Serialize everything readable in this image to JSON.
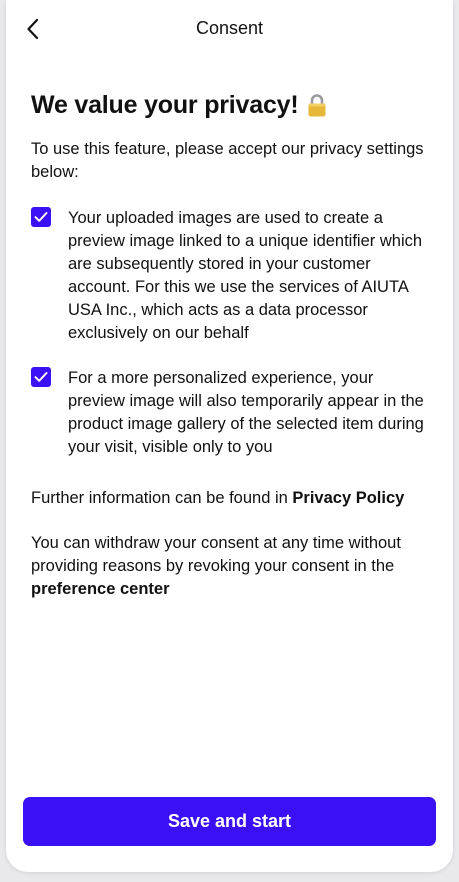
{
  "header": {
    "title": "Consent",
    "back_icon": "chevron-left-icon"
  },
  "main": {
    "headline": "We value your privacy!",
    "headline_icon": "lock-icon",
    "intro": "To use this feature, please accept our privacy settings below:",
    "options": [
      {
        "checked": true,
        "text": "Your uploaded images are used to create a preview image linked to a unique identifier which are subsequently stored in your customer account. For this we use the services of AIUTA USA Inc., which acts as a data processor exclusively on our behalf"
      },
      {
        "checked": true,
        "text": "For a more personalized experience, your preview image will also temporarily appear in the product image gallery of the selected item during your visit, visible only to you"
      }
    ],
    "further_info": {
      "prefix": "Further information can be found in ",
      "link": "Privacy Policy"
    },
    "withdraw": {
      "prefix": "You can withdraw your consent at any time without providing reasons by revoking your consent in the ",
      "link": "preference center"
    }
  },
  "footer": {
    "primary_button": "Save and start"
  },
  "colors": {
    "accent": "#3a10f5",
    "text": "#111111",
    "background": "#ffffff"
  }
}
